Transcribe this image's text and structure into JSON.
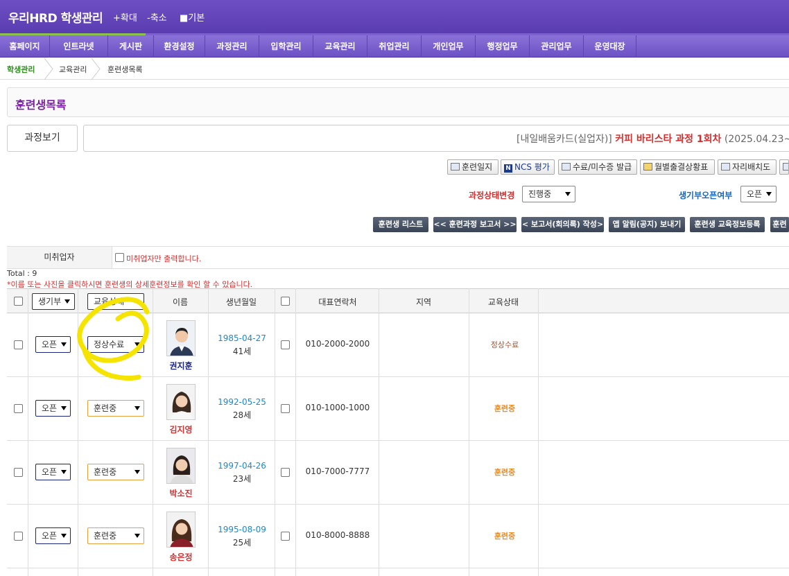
{
  "header": {
    "brand": "우리HRD 학생관리",
    "zoom_in": "+확대",
    "zoom_out": "-축소",
    "default": "■기본"
  },
  "nav": [
    "홈페이지",
    "인트라넷",
    "게시판",
    "환경설정",
    "과정관리",
    "입학관리",
    "교육관리",
    "취업관리",
    "개인업무",
    "행정업무",
    "관리업무",
    "운영대장"
  ],
  "breadcrumb": [
    "학생관리",
    "교육관리",
    "훈련생목록"
  ],
  "page_title": "훈련생목록",
  "course": {
    "button": "과정보기",
    "type": "[내일배움카드(실업자)]",
    "name": "커피 바리스타 과정 1회차",
    "period": "(2025.04.23~"
  },
  "tools": [
    "훈련일지",
    "NCS 평가",
    "수료/미수증 발급",
    "월별출결상황표",
    "자리배치도"
  ],
  "controls": {
    "course_status_label": "과정상태변경",
    "course_status_value": "진행중",
    "record_open_label": "생기부오픈여부",
    "record_open_value": "오픈"
  },
  "actions": [
    "훈련생 리스트",
    "<< 훈련과정 보고서 >>",
    "< 보고서(회의록) 작성>",
    "앱 알림(공지) 보내기",
    "훈련생 교육정보등록",
    "훈련"
  ],
  "filter": {
    "label": "미취업자",
    "note": "미취업자만 출력합니다."
  },
  "total": "Total : 9",
  "hint": "*이름 또는 사진을 클릭하시면 훈련생의 상세훈련정보를 확인 할 수 있습니다.",
  "table": {
    "headers": {
      "record": "생기부",
      "edu_status": "교육상태",
      "name": "이름",
      "birth": "생년월일",
      "phone": "대표연락처",
      "region": "지역",
      "status": "교육상태"
    },
    "rows": [
      {
        "record": "오픈",
        "edu": "정상수료",
        "name": "권지훈",
        "birth": "1985-04-27",
        "age": "41세",
        "phone": "010-2000-2000",
        "status": "정상수료"
      },
      {
        "record": "오픈",
        "edu": "훈련중",
        "name": "김지영",
        "birth": "1992-05-25",
        "age": "28세",
        "phone": "010-1000-1000",
        "status": "훈련중"
      },
      {
        "record": "오픈",
        "edu": "훈련중",
        "name": "박소진",
        "birth": "1997-04-26",
        "age": "23세",
        "phone": "010-7000-7777",
        "status": "훈련중"
      },
      {
        "record": "오픈",
        "edu": "훈련중",
        "name": "송은정",
        "birth": "1995-08-09",
        "age": "25세",
        "phone": "010-8000-8888",
        "status": "훈련중"
      }
    ]
  },
  "colors": {
    "header_purple": "#5a3db0",
    "nav_purple": "#6c51c4",
    "accent_red": "#d32f2f",
    "accent_blue": "#1565c0",
    "highlight": "#f5e400"
  }
}
